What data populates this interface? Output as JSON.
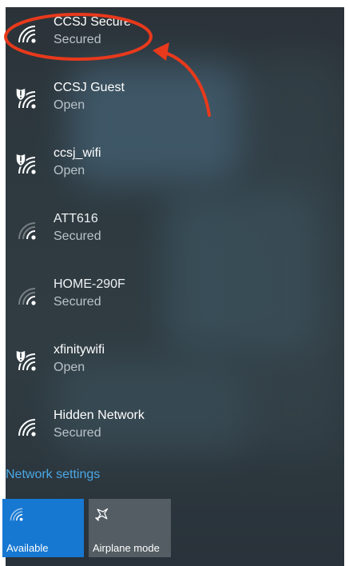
{
  "networks": [
    {
      "ssid": "CCSJ Secure",
      "state": "Secured",
      "icon": "wifi-icon",
      "open": false
    },
    {
      "ssid": "CCSJ Guest",
      "state": "Open",
      "icon": "wifi-shield-icon",
      "open": true
    },
    {
      "ssid": "ccsj_wifi",
      "state": "Open",
      "icon": "wifi-shield-icon",
      "open": true
    },
    {
      "ssid": "ATT616",
      "state": "Secured",
      "icon": "wifi-icon",
      "open": false
    },
    {
      "ssid": "HOME-290F",
      "state": "Secured",
      "icon": "wifi-icon",
      "open": false
    },
    {
      "ssid": "xfinitywifi",
      "state": "Open",
      "icon": "wifi-shield-icon",
      "open": true
    },
    {
      "ssid": "Hidden Network",
      "state": "Secured",
      "icon": "wifi-icon",
      "open": false
    }
  ],
  "network_settings_link": "Network settings",
  "quick_actions": [
    {
      "label": "Available",
      "icon": "wifi-icon",
      "active": true
    },
    {
      "label": "Airplane mode",
      "icon": "airplane-icon",
      "active": false
    }
  ],
  "colors": {
    "panel": "#2e3a40",
    "accent": "#1778d2",
    "link": "#4aa8e6",
    "annotation": "#e8391c"
  }
}
